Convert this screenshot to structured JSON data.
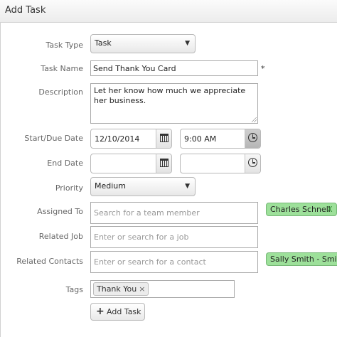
{
  "window": {
    "title": "Add Task"
  },
  "form": {
    "task_type": {
      "label": "Task Type",
      "value": "Task"
    },
    "task_name": {
      "label": "Task Name",
      "value": "Send Thank You Card",
      "required_marker": "*"
    },
    "description": {
      "label": "Description",
      "value": "Let her know how much we appreciate her business."
    },
    "start_due": {
      "label": "Start/Due Date",
      "date": "12/10/2014",
      "time": "9:00 AM"
    },
    "end_date": {
      "label": "End Date",
      "date": "",
      "time": ""
    },
    "priority": {
      "label": "Priority",
      "value": "Medium"
    },
    "assigned_to": {
      "label": "Assigned To",
      "placeholder": "Search for a team member",
      "chips": [
        {
          "name": "Charles Schnell",
          "remove": "X"
        }
      ]
    },
    "related_job": {
      "label": "Related Job",
      "placeholder": "Enter or search for a job"
    },
    "related_contacts": {
      "label": "Related Contacts",
      "placeholder": "Enter or search for a contact",
      "chips": [
        {
          "name": "Sally Smith - Smith"
        }
      ]
    },
    "tags": {
      "label": "Tags",
      "items": [
        {
          "name": "Thank You",
          "remove": "×"
        }
      ]
    },
    "add_task_button": {
      "icon": "+",
      "label": "Add Task"
    }
  },
  "icons": {
    "dropdown": "▼"
  },
  "colors": {
    "chip_green": "#9de09a",
    "chip_border": "#75b775"
  }
}
